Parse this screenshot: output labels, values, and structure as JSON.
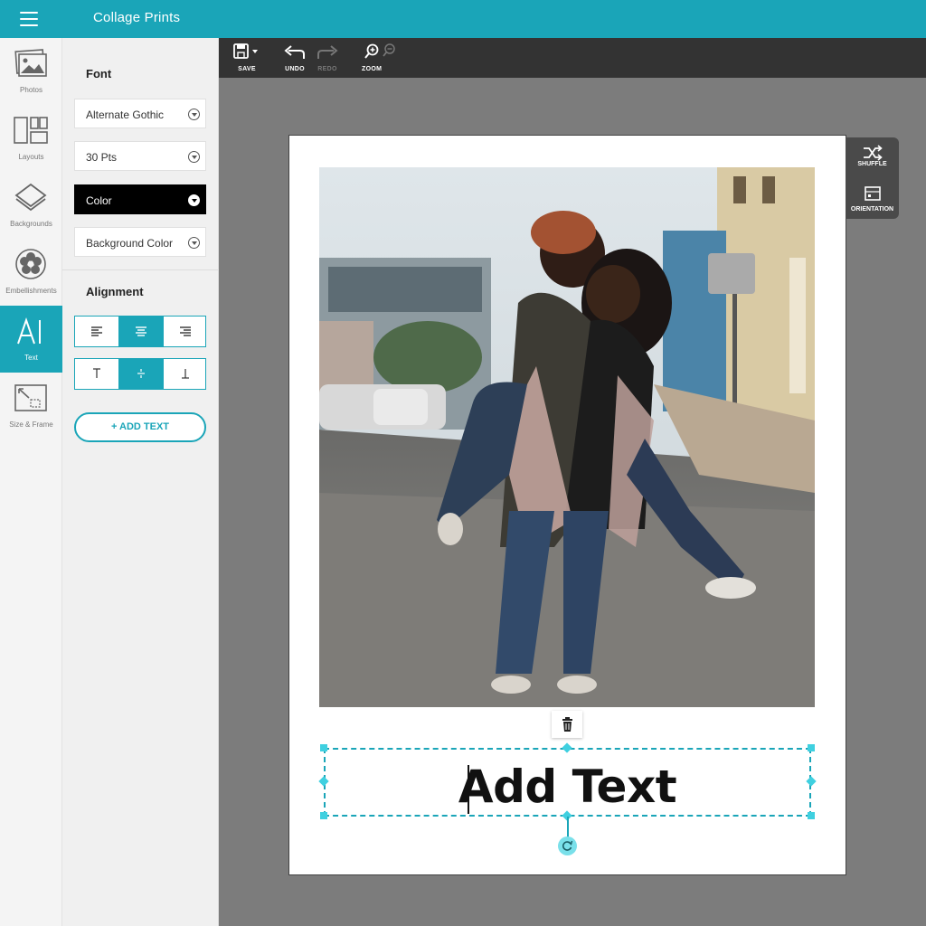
{
  "app": {
    "title": "Collage Prints"
  },
  "rail": {
    "items": [
      {
        "label": "Photos"
      },
      {
        "label": "Layouts"
      },
      {
        "label": "Backgrounds"
      },
      {
        "label": "Embellishments"
      },
      {
        "label": "Text"
      },
      {
        "label": "Size & Frame"
      }
    ]
  },
  "panel": {
    "font_heading": "Font",
    "font_family": "Alternate Gothic",
    "font_size": "30 Pts",
    "color_label": "Color",
    "background_color_label": "Background Color",
    "alignment_heading": "Alignment",
    "add_text_label": "+ ADD TEXT"
  },
  "toolbar": {
    "save_label": "SAVE",
    "undo_label": "UNDO",
    "redo_label": "REDO",
    "zoom_label": "ZOOM"
  },
  "side_tools": {
    "shuffle_label": "SHUFFLE",
    "orientation_label": "ORIENTATION"
  },
  "canvas": {
    "text_value": "Add Text"
  },
  "colors": {
    "accent": "#1aa5b8",
    "toolbar": "#333333",
    "canvas": "#7c7c7c"
  }
}
